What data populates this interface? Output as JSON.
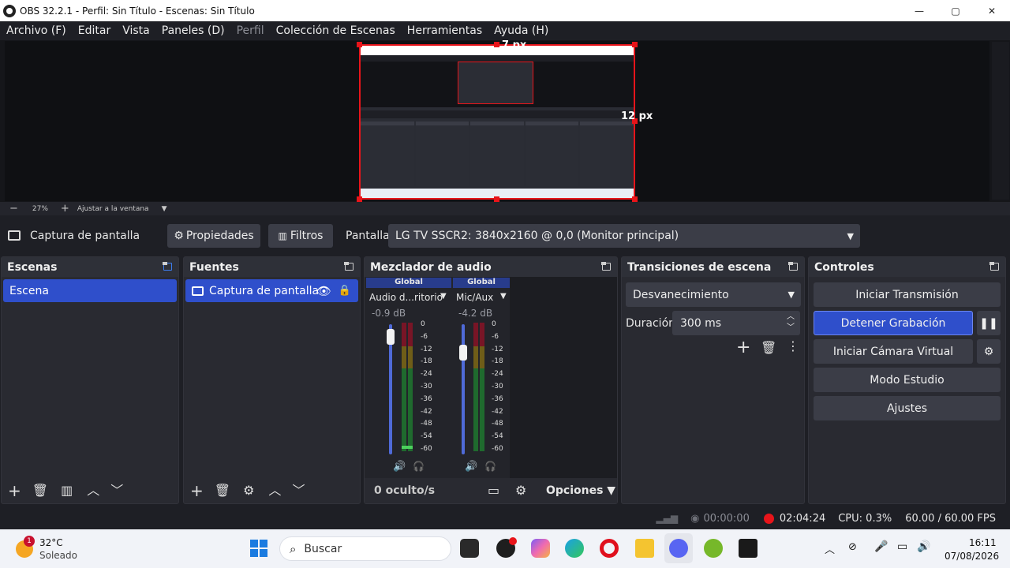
{
  "window": {
    "title": "OBS 32.2.1 - Perfil: Sin Título - Escenas: Sin Título",
    "minimize": "—",
    "maximize": "▢",
    "close": "✕"
  },
  "menu": [
    "Archivo (F)",
    "Editar",
    "Vista",
    "Paneles (D)",
    "Perfil",
    "Colección de Escenas",
    "Herramientas",
    "Ayuda (H)"
  ],
  "preview": {
    "label_top": "7 px",
    "label_right": "12 px"
  },
  "zoom": {
    "minus": "−",
    "value": "27%",
    "plus": "+",
    "fit": "Ajustar a la ventana"
  },
  "source_bar": {
    "source_name": "Captura de pantalla",
    "properties": "Propiedades",
    "filters": "Filtros",
    "display_label": "Pantalla",
    "display_value": "LG TV SSCR2: 3840x2160 @ 0,0 (Monitor principal)"
  },
  "scenes": {
    "title": "Escenas",
    "items": [
      "Escena"
    ]
  },
  "sources": {
    "title": "Fuentes",
    "items": [
      "Captura de pantalla"
    ]
  },
  "mixer": {
    "title": "Mezclador de audio",
    "channels": [
      {
        "badge": "Global",
        "name": "Audio d...ritorio",
        "db": "-0.9 dB",
        "level": 0.92
      },
      {
        "badge": "Global",
        "name": "Mic/Aux",
        "db": "-4.2 dB",
        "level": 0.85
      }
    ],
    "scale": [
      "0",
      "-6",
      "-12",
      "-18",
      "-24",
      "-30",
      "-36",
      "-42",
      "-48",
      "-54",
      "-60"
    ],
    "hidden": "0 oculto/s",
    "options": "Opciones"
  },
  "transitions": {
    "title": "Transiciones de escena",
    "selected": "Desvanecimiento",
    "duration_label": "Duración",
    "duration_value": "300 ms"
  },
  "controls": {
    "title": "Controles",
    "start_stream": "Iniciar Transmisión",
    "stop_record": "Detener Grabación",
    "virtual_cam": "Iniciar Cámara Virtual",
    "studio": "Modo Estudio",
    "settings": "Ajustes"
  },
  "status": {
    "stream_time": "00:00:00",
    "rec_time": "02:04:24",
    "cpu": "CPU: 0.3%",
    "fps": "60.00 / 60.00 FPS"
  },
  "taskbar": {
    "weather_temp": "32°C",
    "weather_desc": "Soleado",
    "weather_badge": "1",
    "search": "Buscar",
    "time": "16:11",
    "date": "07/08/2026"
  },
  "colors": {
    "accent": "#2f4fcb",
    "record": "#e8141a",
    "panel": "#292a31"
  }
}
